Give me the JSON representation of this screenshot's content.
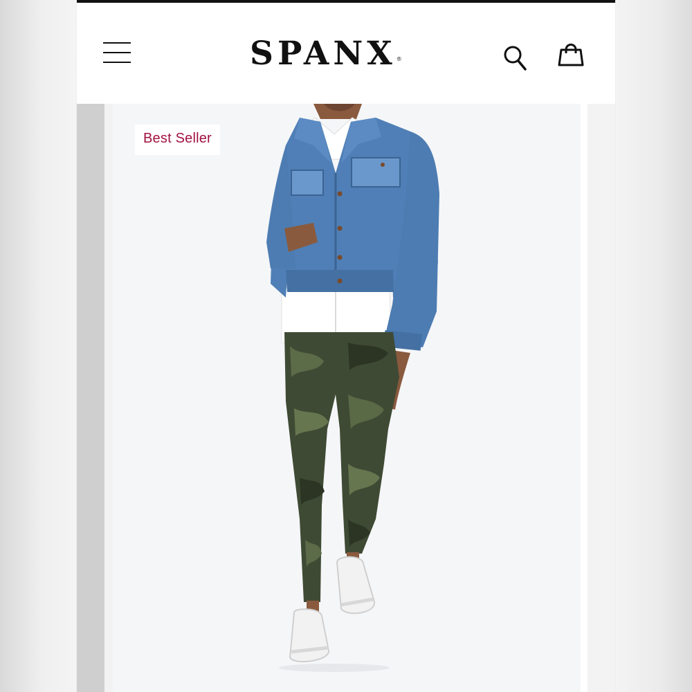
{
  "header": {
    "brand": "SPANX",
    "brand_mark": "®",
    "menu_icon": "hamburger-menu-icon",
    "search_icon": "search-icon",
    "bag_icon": "shopping-bag-icon"
  },
  "product": {
    "badge": "Best Seller",
    "badge_color": "#a11240"
  },
  "colors": {
    "background": "#ffffff",
    "top_border": "#111111",
    "image_background": "#f5f6f8"
  }
}
